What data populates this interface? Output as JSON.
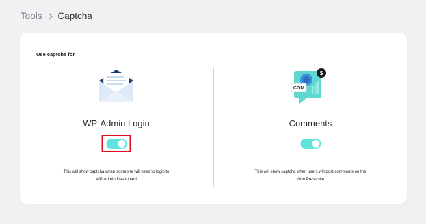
{
  "breadcrumb": {
    "parent": "Tools",
    "current": "Captcha"
  },
  "card": {
    "title": "Use captcha for"
  },
  "options": [
    {
      "label": "WP-Admin Login",
      "enabled": true,
      "icon": "envelope-icon",
      "description_line1": "This will show captcha when someone will need to login to",
      "description_line2": "WP-Admin Dashboard"
    },
    {
      "label": "Comments",
      "enabled": true,
      "icon": "comments-chat-icon",
      "icon_text": "COM",
      "icon_badge": "$",
      "description_line1": "This will show captcha when users will post comments on the",
      "description_line2": "WordPress site"
    }
  ],
  "colors": {
    "toggle_on": "#5fe3dd",
    "highlight": "#e0101f",
    "envelope": "#c9dcf0",
    "envelope_dark": "#1d3f72",
    "chat_bubble": "#5fd8d2"
  }
}
